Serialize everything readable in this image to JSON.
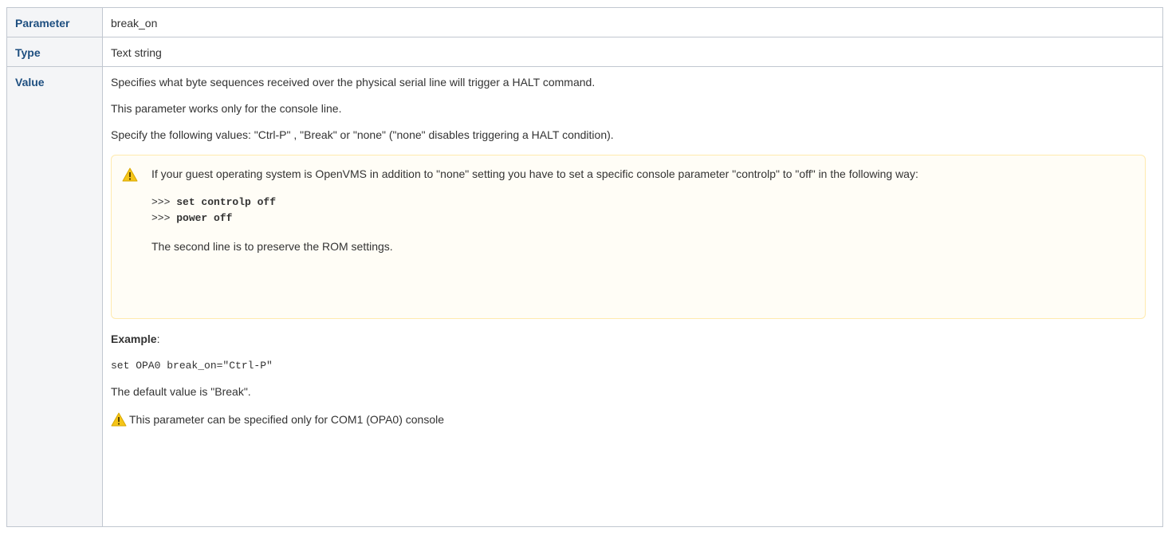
{
  "rows": {
    "parameter": {
      "label": "Parameter",
      "value": "break_on"
    },
    "type": {
      "label": "Type",
      "value": "Text string"
    },
    "value": {
      "label": "Value",
      "description": "Specifies what byte sequences received over the physical serial line will trigger a HALT command.",
      "scope": "This parameter works only for the console line.",
      "options": "Specify the following values: \"Ctrl-P\" , \"Break\" or \"none\" (\"none\" disables triggering a HALT condition).",
      "warning": {
        "icon": "warning-icon",
        "text": "If your guest operating system is OpenVMS in addition to \"none\" setting you have to set a specific console parameter \"controlp\" to \"off\" in the following way:",
        "code": [
          {
            "prompt": ">>> ",
            "command": "set controlp off"
          },
          {
            "prompt": ">>> ",
            "command": "power off"
          }
        ],
        "footer": "The second line is to preserve the ROM settings."
      },
      "example_label": "Example",
      "example_suffix": ":",
      "example_code": "set OPA0 break_on=\"Ctrl-P\"",
      "default_text": "The default value is \"Break\".",
      "note": {
        "icon": "warning-icon",
        "text": "This parameter can be specified only for COM1 (OPA0) console"
      }
    }
  },
  "colors": {
    "header_bg": "#f4f5f7",
    "header_text": "#1e4f80",
    "border": "#c1c7d0",
    "warning_bg": "#fffdf6",
    "warning_border": "#ffeaae",
    "warning_icon": "#f5c518"
  }
}
